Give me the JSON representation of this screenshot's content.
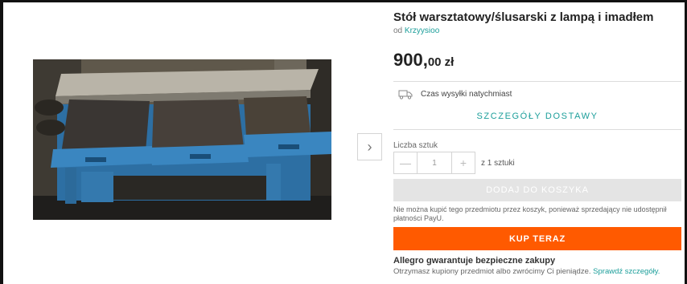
{
  "product": {
    "title": "Stół warsztatowy/ślusarski z lampą i imadłem",
    "seller_prefix": "od",
    "seller_name": "Krzyysioo",
    "price_main": "900,",
    "price_rest": "00 zł"
  },
  "gallery": {
    "next_glyph": "›",
    "icon": "chevron-right-icon"
  },
  "shipping": {
    "time_label": "Czas wysyłki natychmiast",
    "details_link": "SZCZEGÓŁY DOSTAWY",
    "icon": "truck-icon"
  },
  "quantity": {
    "label": "Liczba sztuk",
    "minus": "—",
    "value": "1",
    "plus": "+",
    "available": "z 1 sztuki"
  },
  "cart": {
    "button_label": "DODAJ DO KOSZYKA",
    "note": "Nie można kupić tego przedmiotu przez koszyk, ponieważ sprzedający nie udostępnił płatności PayU."
  },
  "buy": {
    "button_label": "KUP TERAZ"
  },
  "guarantee": {
    "title": "Allegro gwarantuje bezpieczne zakupy",
    "text": "Otrzymasz kupiony przedmiot albo zwrócimy Ci pieniądze.",
    "link": "Sprawdź szczegóły."
  },
  "colors": {
    "accent_teal": "#1b9e9a",
    "buy_orange": "#ff5a00",
    "disabled_gray": "#e4e4e4"
  }
}
